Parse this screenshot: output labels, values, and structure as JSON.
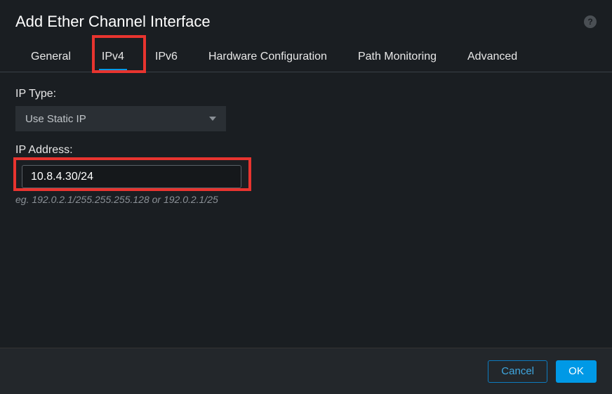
{
  "header": {
    "title": "Add Ether Channel Interface"
  },
  "tabs": [
    {
      "label": "General"
    },
    {
      "label": "IPv4"
    },
    {
      "label": "IPv6"
    },
    {
      "label": "Hardware Configuration"
    },
    {
      "label": "Path Monitoring"
    },
    {
      "label": "Advanced"
    }
  ],
  "form": {
    "ip_type_label": "IP Type:",
    "ip_type_value": "Use Static IP",
    "ip_address_label": "IP Address:",
    "ip_address_value": "10.8.4.30/24",
    "helper": "eg. 192.0.2.1/255.255.255.128 or 192.0.2.1/25"
  },
  "footer": {
    "cancel": "Cancel",
    "ok": "OK"
  }
}
